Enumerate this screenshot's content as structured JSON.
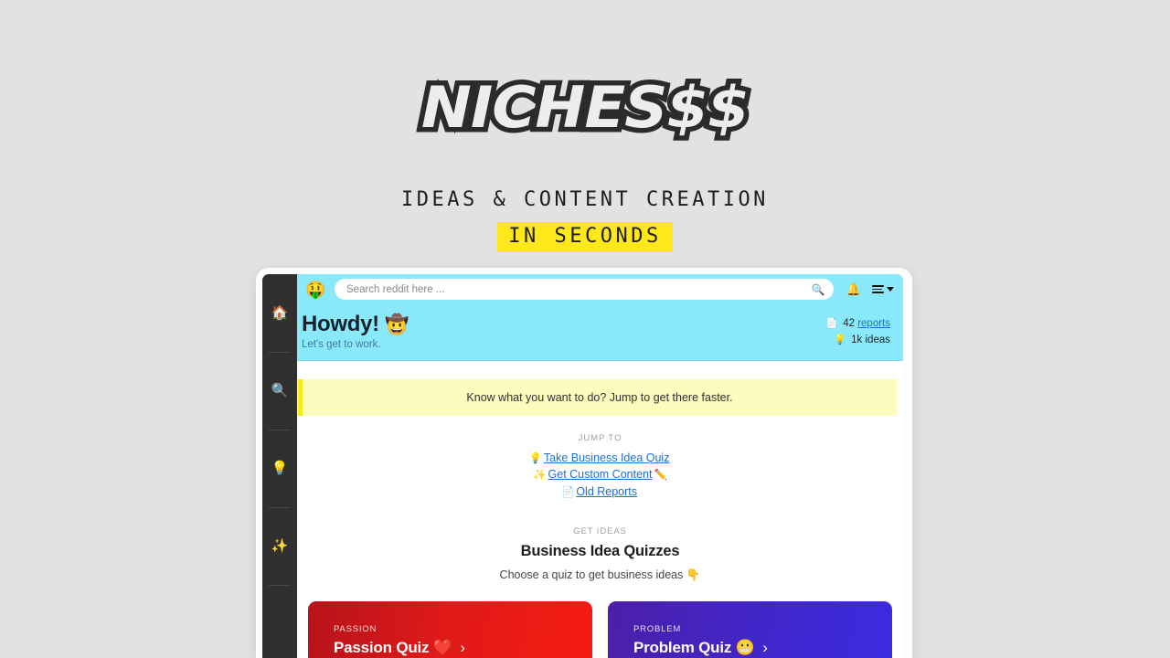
{
  "brand": {
    "logo_text": "NICHES$$",
    "tagline": "IDEAS & CONTENT CREATION",
    "tagline_highlight": "IN SECONDS",
    "highlight_color": "#ffe81a",
    "page_background": "#e2e2e2"
  },
  "sidebar": {
    "items": [
      {
        "name": "home",
        "icon": "house-icon",
        "glyph": "🏠"
      },
      {
        "name": "search",
        "icon": "magnifier-icon",
        "glyph": "🔍"
      },
      {
        "name": "ideas",
        "icon": "lightbulb-icon",
        "glyph": "💡"
      },
      {
        "name": "content",
        "icon": "sparkles-icon",
        "glyph": "✨"
      }
    ]
  },
  "topbar": {
    "avatar_glyph": "🤑",
    "avatar_icon": "money-mouth-avatar",
    "search_placeholder": "Search reddit here ...",
    "search_value": "",
    "search_icon_glyph": "🔍",
    "bell_glyph": "🔔",
    "menu_icon": "hamburger-menu-icon"
  },
  "greeting": {
    "title": "Howdy!",
    "title_emoji": "🤠",
    "subtitle": "Let's get to work.",
    "background": "#8ae8fb",
    "stats": [
      {
        "icon_glyph": "📄",
        "count": "42",
        "label": "reports",
        "is_link": true
      },
      {
        "icon_glyph": "💡",
        "count": "1k",
        "label": "ideas",
        "is_link": false
      }
    ]
  },
  "notice": {
    "text": "Know what you want to do? Jump to get there faster.",
    "background": "#fdfbbe",
    "accent": "#f4ea1c"
  },
  "jump_to": {
    "label": "JUMP TO",
    "links": [
      {
        "lead_glyph": "💡",
        "text": "Take Business Idea Quiz",
        "trail_glyph": ""
      },
      {
        "lead_glyph": "✨",
        "text": "Get Custom Content",
        "trail_glyph": "✏️"
      },
      {
        "lead_glyph": "📄",
        "text": "Old Reports",
        "trail_glyph": ""
      }
    ]
  },
  "get_ideas": {
    "label": "GET IDEAS",
    "title": "Business Idea Quizzes",
    "subtitle": "Choose a quiz to get business ideas",
    "subtitle_emoji": "👇",
    "cards": [
      {
        "kicker": "PASSION",
        "title": "Passion Quiz",
        "emoji": "❤️",
        "arrow": "›",
        "color_from": "#b6131b",
        "color_to": "#f51c12"
      },
      {
        "kicker": "PROBLEM",
        "title": "Problem Quiz",
        "emoji": "😬",
        "arrow": "›",
        "color_from": "#4b1fa8",
        "color_to": "#3b2be0"
      }
    ]
  }
}
